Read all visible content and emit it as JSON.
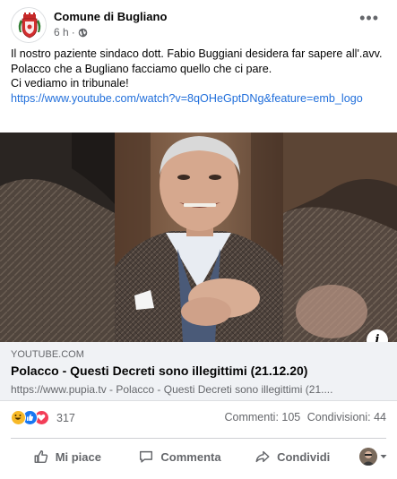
{
  "post": {
    "page_name": "Comune di Bugliano",
    "time": "6 h",
    "privacy_icon": "globe-icon",
    "more_icon": "more-dots-icon",
    "text_lines": [
      "Il nostro paziente sindaco dott. Fabio Buggiani desidera far sapere all'.avv. Polacco che a Bugliano facciamo quello che ci pare.",
      "Ci vediamo in tribunale!"
    ],
    "link": "https://www.youtube.com/watch?v=8qOHeGptDNg&feature=emb_logo"
  },
  "preview": {
    "domain": "YOUTUBE.COM",
    "title": "Polacco - Questi Decreti sono illegittimi (21.12.20)",
    "description": "https://www.pupia.tv - Polacco - Questi Decreti sono illegittimi (21...."
  },
  "stats": {
    "reaction_icons": [
      "haha-icon",
      "like-icon",
      "love-icon"
    ],
    "reaction_count": "317",
    "comments": "Commenti: 105",
    "shares": "Condivisioni: 44"
  },
  "actions": {
    "like": "Mi piace",
    "comment": "Commenta",
    "share": "Condividi"
  },
  "colors": {
    "link": "#216fdb",
    "secondary_text": "#65676b",
    "like_blue": "#1877f2",
    "love_red": "#f33e58",
    "haha_yellow": "#f7b928"
  }
}
